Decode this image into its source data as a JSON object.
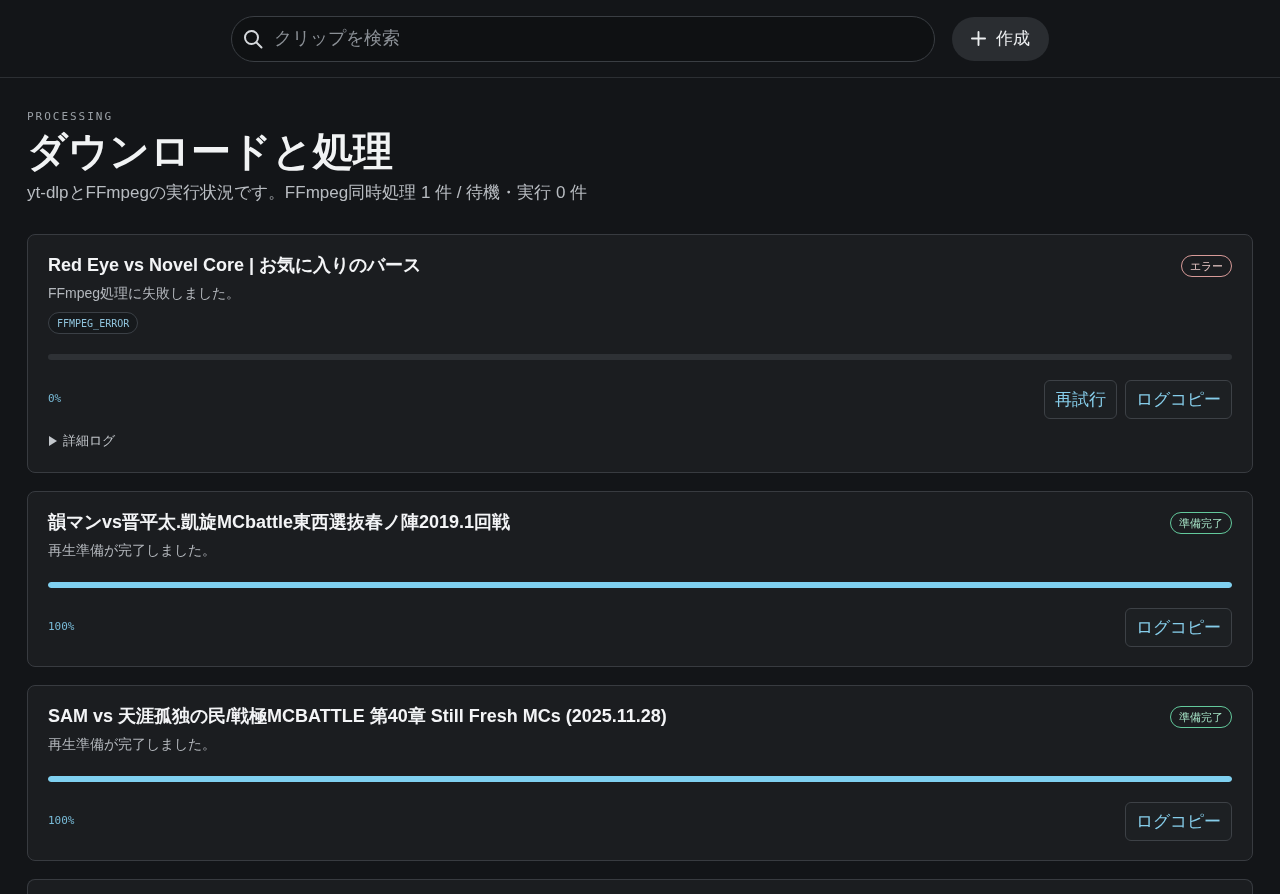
{
  "header": {
    "search": {
      "placeholder": "クリップを検索"
    },
    "create_button": {
      "label": "作成"
    }
  },
  "page": {
    "eyebrow": "PROCESSING",
    "title": "ダウンロードと処理",
    "subtitle": "yt-dlpとFFmpegの実行状況です。FFmpeg同時処理 1 件 / 待機・実行 0 件"
  },
  "jobs": [
    {
      "title": "Red Eye vs Novel Core | お気に入りのバース",
      "status": {
        "kind": "error",
        "label": "エラー"
      },
      "message": "FFmpeg処理に失敗しました。",
      "error_code": "FFMPEG_ERROR",
      "level": 0,
      "percent": "0%",
      "actions": [
        "再試行",
        "ログコピー"
      ],
      "details": {
        "label": "詳細ログ",
        "expanded": false
      }
    },
    {
      "title": "韻マンvs晋平太.凱旋MCbattle東西選抜春ノ陣2019.1回戦",
      "status": {
        "kind": "ready",
        "label": "準備完了"
      },
      "message": "再生準備が完了しました。",
      "level": 1,
      "percent": "100%",
      "actions": [
        "ログコピー"
      ]
    },
    {
      "title": "SAM vs 天涯孤独の民/戦極MCBATTLE 第40章 Still Fresh MCs (2025.11.28)",
      "status": {
        "kind": "ready",
        "label": "準備完了"
      },
      "message": "再生準備が完了しました。",
      "level": 1,
      "percent": "100%",
      "actions": [
        "ログコピー"
      ]
    }
  ]
}
